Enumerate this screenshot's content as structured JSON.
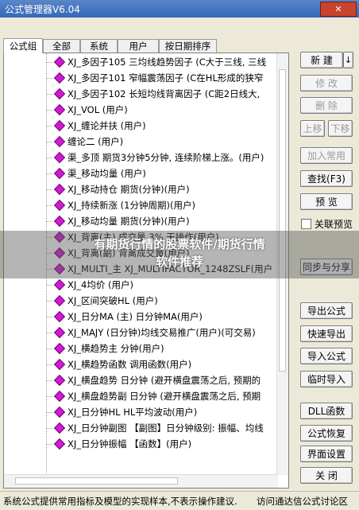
{
  "window": {
    "title": "公式管理器V6.04",
    "close_label": "✕"
  },
  "tabs": [
    "公式组",
    "全部",
    "系统",
    "用户",
    "按日期排序"
  ],
  "tree_rows": [
    "XJ_多因子105   三均线趋势因子  (C大于三线, 三线",
    "XJ_多因子101   窄幅震荡因子  (C在HL形成的狭窄",
    "XJ_多因子102   长短均线背离因子  (C距2日线大,",
    "XJ_VOL   (用户)",
    "XJ_缠论并扶   (用户)",
    "缠论二   (用户)",
    "渠_多顶   期货3分钟5分钟, 连续阶梯上涨。(用户)",
    "渠_移动均量   (用户)",
    "XJ_移动持仓   期货(分钟)(用户)",
    "XJ_持续新涨   (1分钟周期)(用户)",
    "XJ_移动均量   期货(分钟)(用户)",
    "XJ_背离(主)   成交量 3% 天操作(用户)",
    "XJ_背离(副)   背离成交量(用户)",
    "XJ_MULTI_主   XJ_MULTIFACTOR_1248ZSLF(用户",
    "XJ_4均价   (用户)",
    "XJ_区间突破HL   (用户)",
    "XJ_日分MA     (主)  日分钟MA(用户)",
    "XJ_MAJY   (日分钟)均线交易推广(用户)(可交易)",
    "XJ_横趋势主   分钟(用户)",
    "XJ_横趋势函数   调用函数(用户)",
    "XJ_横盘趋势   日分钟   (避开横盘震荡之后, 预期的",
    "XJ_横盘趋势副   日分钟   (避开横盘震荡之后, 预期",
    "XJ_日分钟HL   HL平均波动(用户)",
    "XJ_日分钟副图   【副图】日分钟级别: 振幅、均线",
    "XJ_日分钟振幅   【函数】(用户)"
  ],
  "buttons": {
    "new": "新 建",
    "new_arrow": "↓",
    "edit": "修 改",
    "delete": "删 除",
    "move_up": "上移",
    "move_down": "下移",
    "add_common": "加入常用",
    "find": "查找(F3)",
    "preview": "预 览",
    "sync_share": "同步与分享",
    "export": "导出公式",
    "quick_export": "快速导出",
    "import": "导入公式",
    "temp_import": "临时导入",
    "dll": "DLL函数",
    "restore": "公式恢复",
    "ui_settings": "界面设置",
    "close": "关 闭"
  },
  "checkbox_label": "关联预览",
  "status": {
    "left": "系统公式提供常用指标及模型的实现样本,不表示操作建议.",
    "right": "访问通达信公式讨论区"
  },
  "watermark": {
    "line1": "有期货行情的股票软件/期货行情",
    "line2": "软件推荐"
  }
}
